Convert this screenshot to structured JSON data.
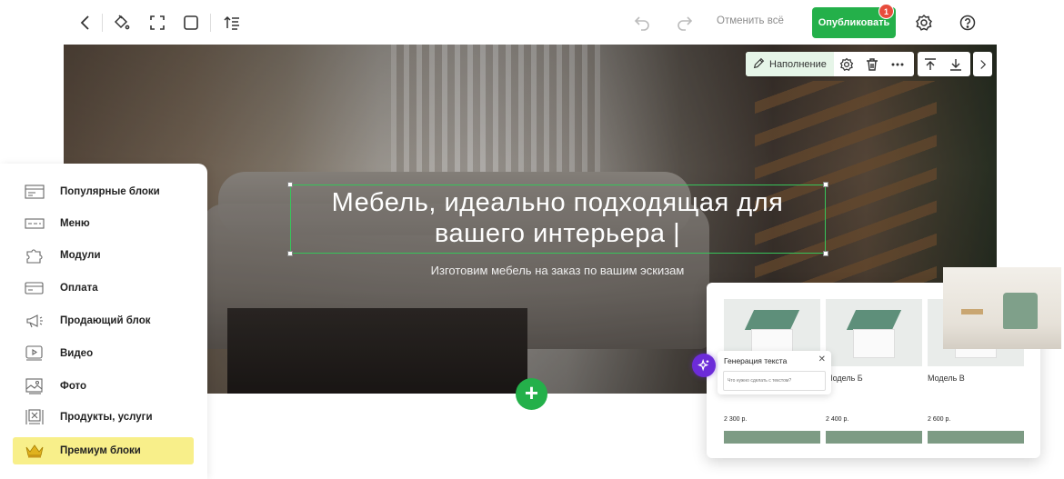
{
  "toolbar": {
    "cancel_all": "Отменить всё",
    "publish": "Опубликовать",
    "publish_badge": "1",
    "accent": "#24b04a"
  },
  "hero": {
    "title": "Мебель, идеально подходящая  для вашего интерьера |",
    "subtitle": "Изготовим мебель на заказ по вашим эскизам"
  },
  "block_toolbar": {
    "fill_label": "Наполнение"
  },
  "sidebar": {
    "items": [
      {
        "label": "Популярные блоки",
        "icon": "popular-blocks-icon"
      },
      {
        "label": "Меню",
        "icon": "menu-icon"
      },
      {
        "label": "Модули",
        "icon": "puzzle-icon"
      },
      {
        "label": "Оплата",
        "icon": "payment-card-icon"
      },
      {
        "label": "Продающий блок",
        "icon": "megaphone-icon"
      },
      {
        "label": "Видео",
        "icon": "video-icon"
      },
      {
        "label": "Фото",
        "icon": "photo-icon"
      },
      {
        "label": "Продукты, услуги",
        "icon": "products-icon"
      },
      {
        "label": "Премиум блоки",
        "icon": "crown-icon"
      }
    ],
    "premium_color": "#f8ef8a"
  },
  "preview": {
    "cards": [
      {
        "name": "",
        "price": "2 300 р."
      },
      {
        "name": "Модель Б",
        "price": "2 400 р."
      },
      {
        "name": "Модель В",
        "price": "2 600 р."
      }
    ],
    "ai_panel": {
      "title": "Генерация текста",
      "placeholder": "Что нужно сделать с текстом?"
    }
  }
}
